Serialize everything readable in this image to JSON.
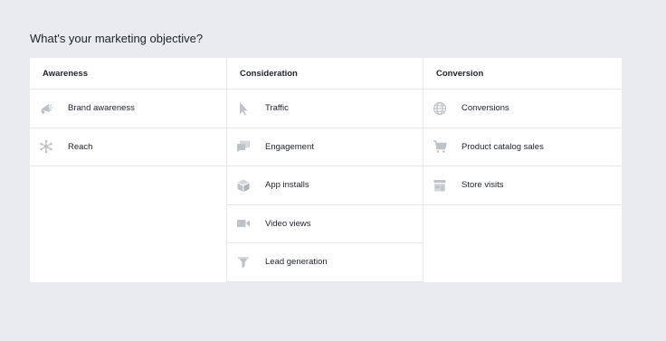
{
  "page": {
    "title": "What's your marketing objective?"
  },
  "columns": [
    {
      "header": "Awareness",
      "options": [
        {
          "label": "Brand awareness",
          "icon": "megaphone-icon"
        },
        {
          "label": "Reach",
          "icon": "reach-icon"
        }
      ]
    },
    {
      "header": "Consideration",
      "options": [
        {
          "label": "Traffic",
          "icon": "cursor-icon"
        },
        {
          "label": "Engagement",
          "icon": "chat-bubbles-icon"
        },
        {
          "label": "App installs",
          "icon": "box-icon"
        },
        {
          "label": "Video views",
          "icon": "video-camera-icon"
        },
        {
          "label": "Lead generation",
          "icon": "funnel-icon"
        }
      ]
    },
    {
      "header": "Conversion",
      "options": [
        {
          "label": "Conversions",
          "icon": "globe-icon"
        },
        {
          "label": "Product catalog sales",
          "icon": "shopping-cart-icon"
        },
        {
          "label": "Store visits",
          "icon": "storefront-icon"
        }
      ]
    }
  ],
  "colors": {
    "background": "#e9ebee",
    "card": "#ffffff",
    "icon": "#bec3c9",
    "divider": "#e5e7eb"
  }
}
